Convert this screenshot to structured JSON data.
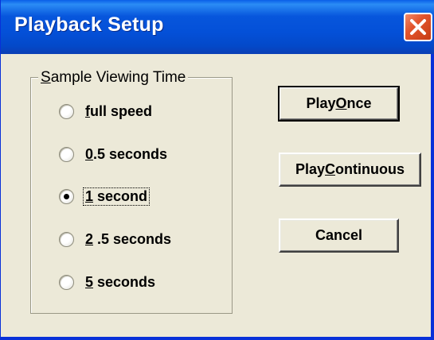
{
  "window": {
    "title": "Playback Setup"
  },
  "group": {
    "legend_first": "S",
    "legend_rest": "ample Viewing Time"
  },
  "options": [
    {
      "mnemonic": "f",
      "rest": "ull speed",
      "selected": false
    },
    {
      "mnemonic": "0",
      "rest": ".5 seconds",
      "selected": false
    },
    {
      "mnemonic": "1",
      "rest": " second",
      "selected": true
    },
    {
      "mnemonic": "2",
      "rest": " .5 seconds",
      "selected": false
    },
    {
      "mnemonic": "5",
      "rest": " seconds",
      "selected": false
    }
  ],
  "buttons": {
    "play_once": {
      "pre": "Play ",
      "mnemonic": "O",
      "post": "nce"
    },
    "play_continuous": {
      "pre": "Play ",
      "mnemonic": "C",
      "post": "ontinuous"
    },
    "cancel": {
      "label": "Cancel"
    }
  },
  "colors": {
    "titlebar": "#0450d8",
    "close": "#e2542c",
    "face": "#ece9d8"
  }
}
